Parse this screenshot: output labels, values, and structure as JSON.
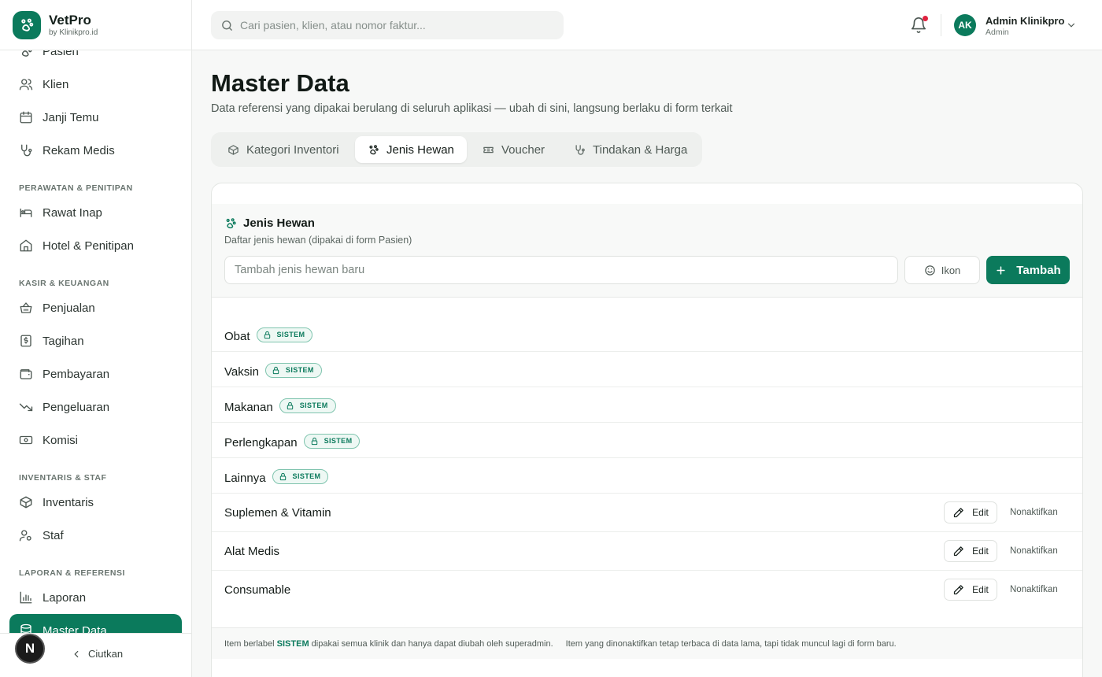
{
  "brand": {
    "name": "VetPro",
    "sub": "by Klinikpro.id"
  },
  "sidebar": {
    "items_top": [
      {
        "label": "Pasien",
        "icon": "paw-icon"
      },
      {
        "label": "Klien",
        "icon": "users-icon"
      },
      {
        "label": "Janji Temu",
        "icon": "calendar-icon"
      },
      {
        "label": "Rekam Medis",
        "icon": "stethoscope-icon"
      }
    ],
    "sections": [
      {
        "title": "PERAWATAN & PENITIPAN",
        "items": [
          {
            "label": "Rawat Inap",
            "icon": "bed-icon"
          },
          {
            "label": "Hotel & Penitipan",
            "icon": "home-icon"
          }
        ]
      },
      {
        "title": "KASIR & KEUANGAN",
        "items": [
          {
            "label": "Penjualan",
            "icon": "basket-icon"
          },
          {
            "label": "Tagihan",
            "icon": "invoice-icon"
          },
          {
            "label": "Pembayaran",
            "icon": "wallet-icon"
          },
          {
            "label": "Pengeluaran",
            "icon": "trending-down-icon"
          },
          {
            "label": "Komisi",
            "icon": "banknote-icon"
          }
        ]
      },
      {
        "title": "INVENTARIS & STAF",
        "items": [
          {
            "label": "Inventaris",
            "icon": "package-icon"
          },
          {
            "label": "Staf",
            "icon": "user-cog-icon"
          }
        ]
      },
      {
        "title": "LAPORAN & REFERENSI",
        "items": [
          {
            "label": "Laporan",
            "icon": "bar-chart-icon"
          },
          {
            "label": "Master Data",
            "icon": "database-icon",
            "active": true
          }
        ]
      }
    ],
    "collapse_label": "Ciutkan",
    "avatar_letter": "N"
  },
  "topbar": {
    "search_placeholder": "Cari pasien, klien, atau nomor faktur...",
    "user": {
      "initials": "AK",
      "name": "Admin Klinikpro",
      "role": "Admin"
    }
  },
  "page": {
    "title": "Master Data",
    "subtitle": "Data referensi yang dipakai berulang di seluruh aplikasi — ubah di sini, langsung berlaku di form terkait"
  },
  "tabs": [
    {
      "label": "Kategori Inventori",
      "icon": "box-icon"
    },
    {
      "label": "Jenis Hewan",
      "icon": "paw-icon",
      "active": true
    },
    {
      "label": "Voucher",
      "icon": "ticket-icon"
    },
    {
      "label": "Tindakan & Harga",
      "icon": "stethoscope-icon"
    }
  ],
  "panel": {
    "title": "Jenis Hewan",
    "subtitle": "Daftar jenis hewan (dipakai di form Pasien)",
    "input_placeholder": "Tambah jenis hewan baru",
    "icon_button": "Ikon",
    "add_button": "Tambah",
    "system_badge": "SISTEM",
    "edit_label": "Edit",
    "deactivate_label": "Nonaktifkan",
    "rows": [
      {
        "name": "Obat",
        "system": true
      },
      {
        "name": "Vaksin",
        "system": true
      },
      {
        "name": "Makanan",
        "system": true
      },
      {
        "name": "Perlengkapan",
        "system": true
      },
      {
        "name": "Lainnya",
        "system": true
      },
      {
        "name": "Suplemen & Vitamin",
        "system": false
      },
      {
        "name": "Alat Medis",
        "system": false
      },
      {
        "name": "Consumable",
        "system": false
      }
    ],
    "footer": {
      "note1_pre": "Item berlabel",
      "note1_bold": "SISTEM",
      "note1_post": "dipakai semua klinik dan hanya dapat diubah oleh superadmin.",
      "note2": "Item yang dinonaktifkan tetap terbaca di data lama, tapi tidak muncul lagi di form baru."
    }
  },
  "colors": {
    "primary": "#0b7a5c",
    "notification": "#e0223f"
  }
}
